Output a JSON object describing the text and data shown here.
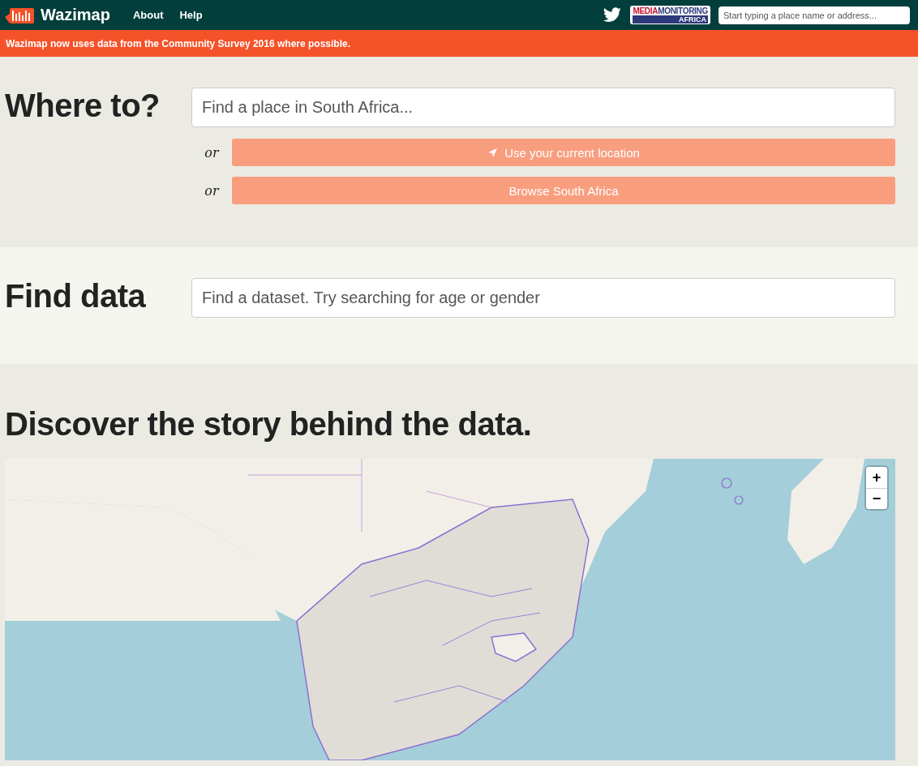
{
  "header": {
    "brand": "Wazimap",
    "nav": [
      {
        "label": "About"
      },
      {
        "label": "Help"
      }
    ],
    "partner_logo": {
      "part_1": "MEDIA",
      "part_2": "MONITORING",
      "part_3": "AFRICA"
    },
    "search": {
      "placeholder": "Start typing a place name or address..."
    }
  },
  "banner": "Wazimap now uses data from the Community Survey 2016 where possible.",
  "where_to": {
    "title": "Where to?",
    "search": {
      "placeholder": "Find a place in South Africa..."
    },
    "options": [
      {
        "kind": "location",
        "or": "or",
        "label": "Use your current location"
      },
      {
        "kind": "browse",
        "or": "or",
        "label": "Browse South Africa"
      }
    ]
  },
  "find_data": {
    "title": "Find data",
    "search": {
      "placeholder": "Find a dataset. Try searching for age or gender"
    }
  },
  "discover": {
    "title": "Discover the story behind the data.",
    "map": {
      "kind": "picture",
      "zoom_in": "+",
      "zoom_out": "−"
    }
  }
}
